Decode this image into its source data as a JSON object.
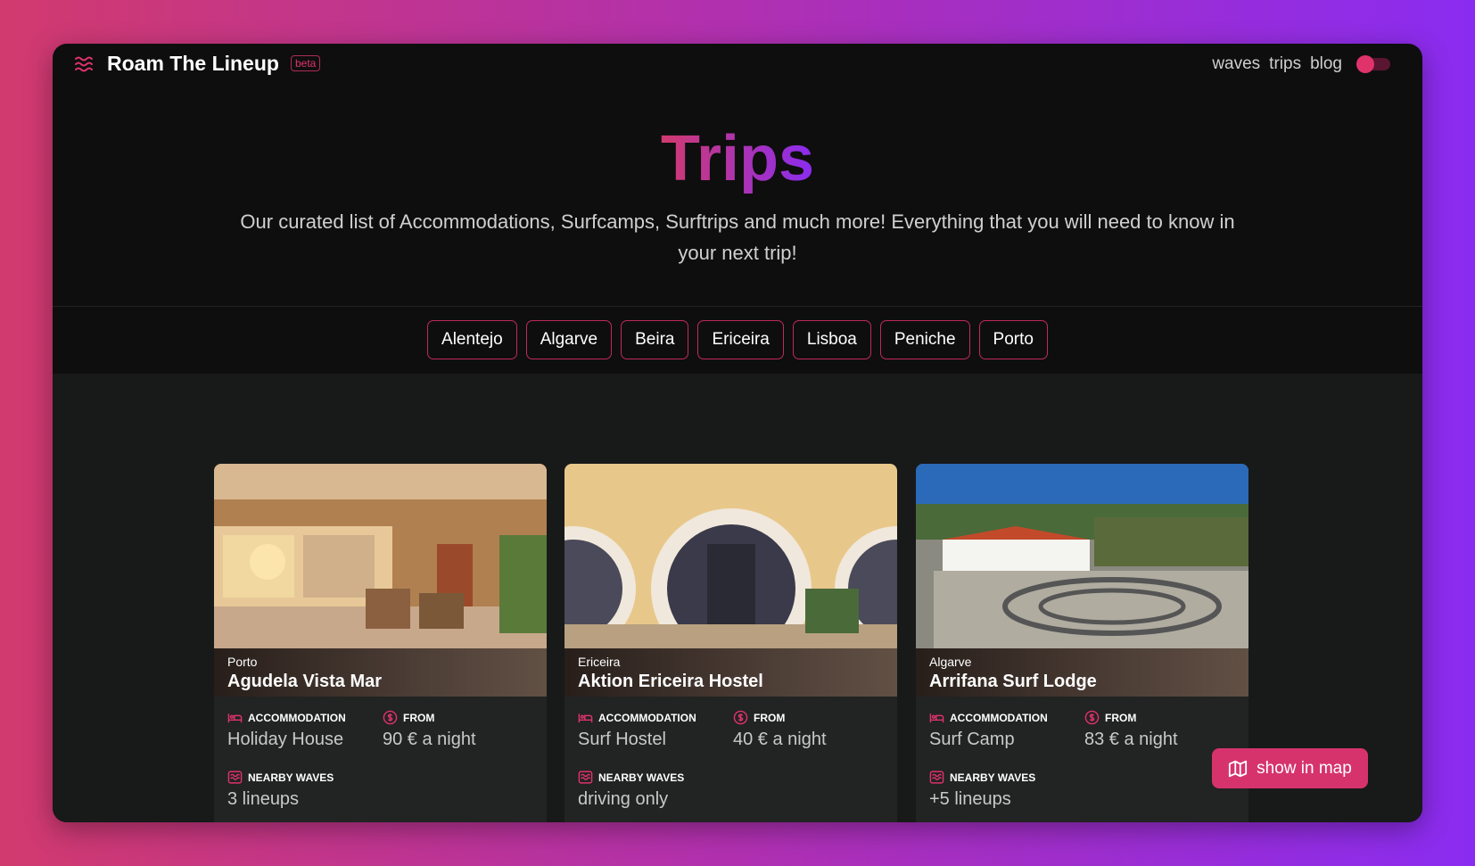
{
  "header": {
    "brand": "Roam The Lineup",
    "badge": "beta",
    "nav": [
      "waves",
      "trips",
      "blog"
    ]
  },
  "hero": {
    "title": "Trips",
    "subtitle": "Our curated list of Accommodations, Surfcamps, Surftrips and much more! Everything that you will need to know in your next trip!"
  },
  "filters": [
    "Alentejo",
    "Algarve",
    "Beira",
    "Ericeira",
    "Lisboa",
    "Peniche",
    "Porto"
  ],
  "labels": {
    "accommodation": "ACCOMMODATION",
    "from": "FROM",
    "nearby": "NEARBY WAVES"
  },
  "cards": [
    {
      "region": "Porto",
      "name": "Agudela Vista Mar",
      "accommodation": "Holiday House",
      "price": "90 € a night",
      "waves": "3 lineups"
    },
    {
      "region": "Ericeira",
      "name": "Aktion Ericeira Hostel",
      "accommodation": "Surf Hostel",
      "price": "40 € a night",
      "waves": "driving only"
    },
    {
      "region": "Algarve",
      "name": "Arrifana Surf Lodge",
      "accommodation": "Surf Camp",
      "price": "83 € a night",
      "waves": "+5 lineups"
    }
  ],
  "map_button": "show in map",
  "colors": {
    "accent": "#e0336c",
    "gradient_start": "#d13a6e",
    "gradient_end": "#8a2cf0"
  }
}
